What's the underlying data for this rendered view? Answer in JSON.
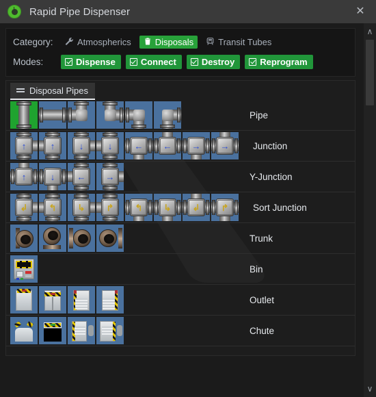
{
  "window": {
    "title": "Rapid Pipe Dispenser",
    "icon": "dispenser-eye-icon",
    "close_label": "✕"
  },
  "options": {
    "category_label": "Category:",
    "categories": [
      {
        "label": "Atmospherics",
        "icon": "wrench-icon",
        "glyph": "🔧",
        "selected": false
      },
      {
        "label": "Disposals",
        "icon": "trash-bin-icon",
        "glyph": "🗑",
        "selected": true
      },
      {
        "label": "Transit Tubes",
        "icon": "tram-icon",
        "glyph": "🚇",
        "selected": false
      }
    ],
    "modes_label": "Modes:",
    "modes": [
      {
        "label": "Dispense",
        "checked": true
      },
      {
        "label": "Connect",
        "checked": true
      },
      {
        "label": "Destroy",
        "checked": true
      },
      {
        "label": "Reprogram",
        "checked": true
      }
    ]
  },
  "content": {
    "tab": {
      "label": "Disposal Pipes",
      "icon": "menu-lines-icon",
      "active": true
    },
    "rows": [
      {
        "label": "Pipe",
        "count": 6,
        "kind": "pipe"
      },
      {
        "label": "Junction",
        "count": 8,
        "kind": "junction"
      },
      {
        "label": "Y-Junction",
        "count": 4,
        "kind": "yjunction"
      },
      {
        "label": "Sort Junction",
        "count": 8,
        "kind": "sort"
      },
      {
        "label": "Trunk",
        "count": 4,
        "kind": "trunk"
      },
      {
        "label": "Bin",
        "count": 1,
        "kind": "bin"
      },
      {
        "label": "Outlet",
        "count": 4,
        "kind": "outlet"
      },
      {
        "label": "Chute",
        "count": 4,
        "kind": "chute"
      }
    ]
  },
  "scrollbar": {
    "up_glyph": "∧",
    "down_glyph": "∨"
  },
  "colors": {
    "accent_green": "#21963a",
    "selected_green": "#28a23a",
    "cell_blue": "#4a719e",
    "cell_green": "#1fa32f",
    "titlebar": "#3a3a3a",
    "panel_bg": "#151515",
    "content_bg": "#1d1d1d",
    "text": "#e6e9ed",
    "arrow_blue": "#2a4cd7",
    "arrow_gold": "#c8a521"
  }
}
